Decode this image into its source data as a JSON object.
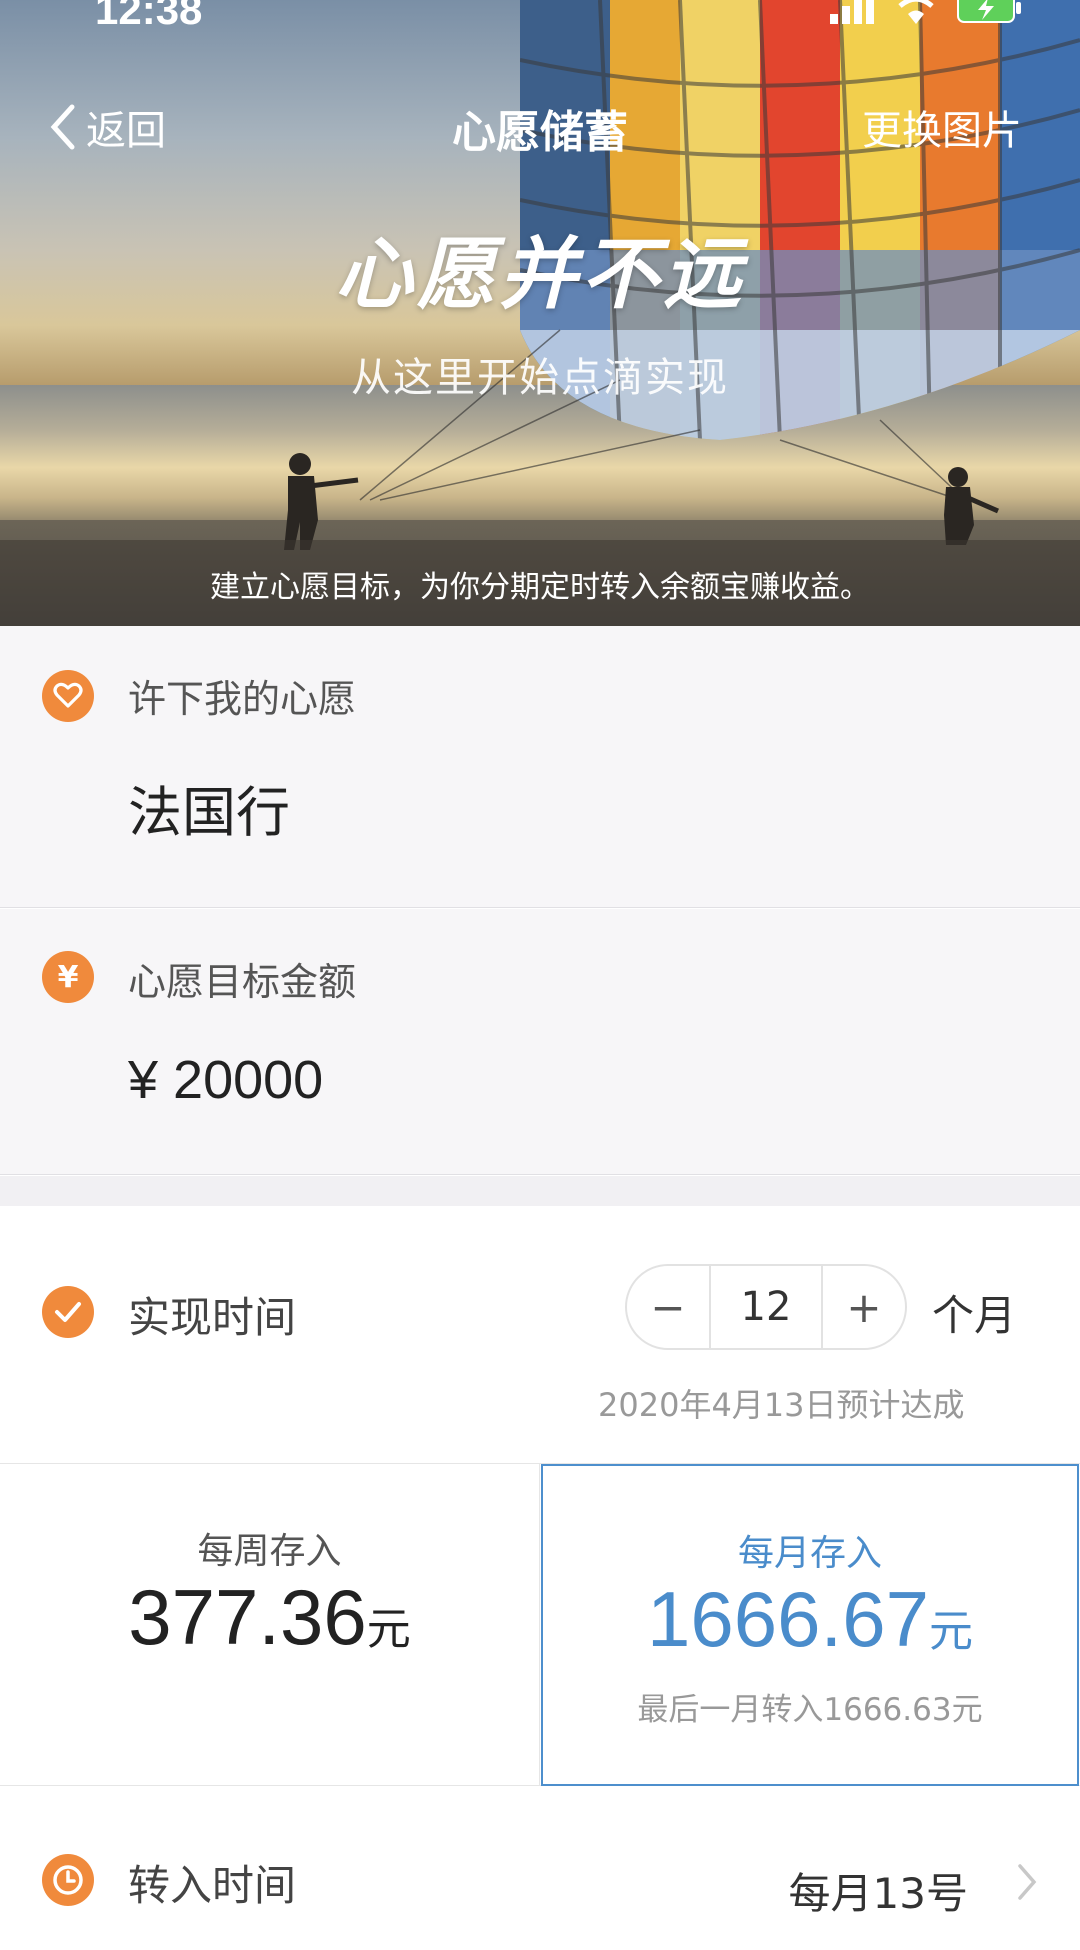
{
  "status_bar": {
    "time": "12:38"
  },
  "nav": {
    "back_label": "返回",
    "title": "心愿储蓄",
    "right_label": "更换图片"
  },
  "hero": {
    "calligraphy": "心愿并不远",
    "subtitle": "从这里开始点滴实现",
    "caption": "建立心愿目标，为你分期定时转入余额宝赚收益。"
  },
  "wish": {
    "label": "许下我的心愿",
    "value": "法国行"
  },
  "amount": {
    "label": "心愿目标金额",
    "value": "¥ 20000",
    "icon": "¥"
  },
  "duration": {
    "label": "实现时间",
    "minus": "−",
    "value": "12",
    "plus": "+",
    "unit": "个月",
    "estimate": "2020年4月13日预计达成"
  },
  "plans": {
    "weekly": {
      "title": "每周存入",
      "amount": "377.36",
      "unit": "元"
    },
    "monthly": {
      "title": "每月存入",
      "amount": "1666.67",
      "unit": "元",
      "note": "最后一月转入1666.63元",
      "selected": true
    }
  },
  "transfer": {
    "label": "转入时间",
    "value": "每月13号"
  },
  "colors": {
    "accent_orange": "#f08a3c",
    "selected_blue": "#4a8ccb"
  }
}
